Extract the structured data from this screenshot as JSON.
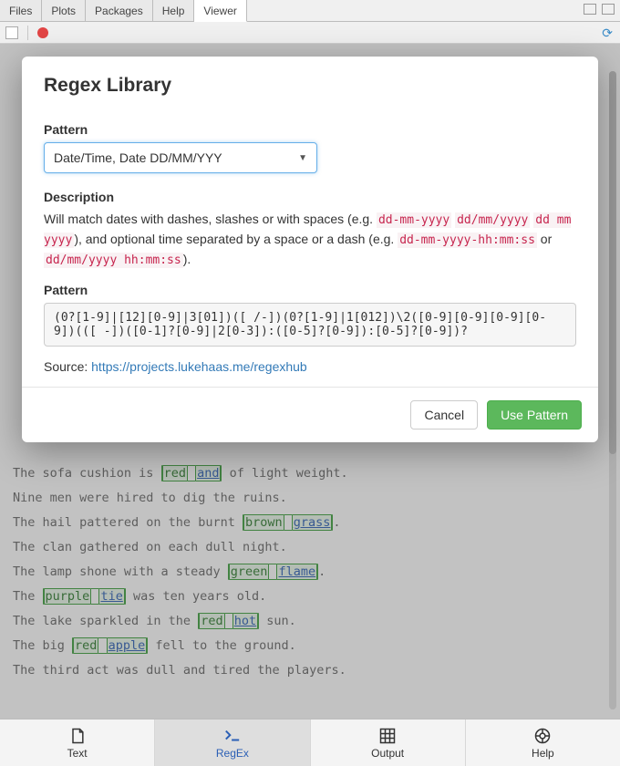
{
  "top_tabs": [
    "Files",
    "Plots",
    "Packages",
    "Help",
    "Viewer"
  ],
  "bottom_tabs": [
    {
      "label": "Text",
      "icon": "file-icon"
    },
    {
      "label": "RegEx",
      "icon": "terminal-icon"
    },
    {
      "label": "Output",
      "icon": "grid-icon"
    },
    {
      "label": "Help",
      "icon": "help-icon"
    }
  ],
  "bg_lines": [
    {
      "pre": "The sofa cushion is ",
      "g": "red",
      "b": "and",
      "post": " of light weight."
    },
    {
      "pre": "Nine men were hired to dig the ruins."
    },
    {
      "pre": "The hail pattered on the burnt ",
      "g": "brown",
      "b": "grass",
      "post": "."
    },
    {
      "pre": "The clan gathered on each dull night."
    },
    {
      "pre": "The lamp shone with a steady ",
      "g": "green",
      "b": "flame",
      "post": "."
    },
    {
      "pre": "The ",
      "g": "purple",
      "b": "tie",
      "post": " was ten years old."
    },
    {
      "pre": "The lake sparkled in the ",
      "g": "red",
      "b": "hot",
      "post": " sun."
    },
    {
      "pre": "The big ",
      "g": "red",
      "b": "apple",
      "post": " fell to the ground."
    },
    {
      "pre": "The third act was dull and tired the players."
    }
  ],
  "modal": {
    "title": "Regex Library",
    "pattern_label": "Pattern",
    "pattern_select": "Date/Time, Date DD/MM/YYY",
    "desc_label": "Description",
    "desc_pre": "Will match dates with dashes, slashes or with spaces (e.g. ",
    "desc_codes1": [
      "dd-mm-yyyy",
      "dd/mm/yyyy",
      "dd mm yyyy"
    ],
    "desc_mid": "), and optional time separated by a space or a dash (e.g. ",
    "desc_codes2": [
      "dd-mm-yyyy-hh:mm:ss"
    ],
    "desc_or": " or ",
    "desc_codes3": [
      "dd/mm/yyyy hh:mm:ss"
    ],
    "desc_post": ").",
    "pattern_value": "(0?[1-9]|[12][0-9]|3[01])([ /-])(0?[1-9]|1[012])\\2([0-9][0-9][0-9][0-9])(([ -])([0-1]?[0-9]|2[0-3]):([0-5]?[0-9]):[0-5]?[0-9])?",
    "source_label": "Source: ",
    "source_link": "https://projects.lukehaas.me/regexhub",
    "cancel": "Cancel",
    "use": "Use Pattern"
  }
}
